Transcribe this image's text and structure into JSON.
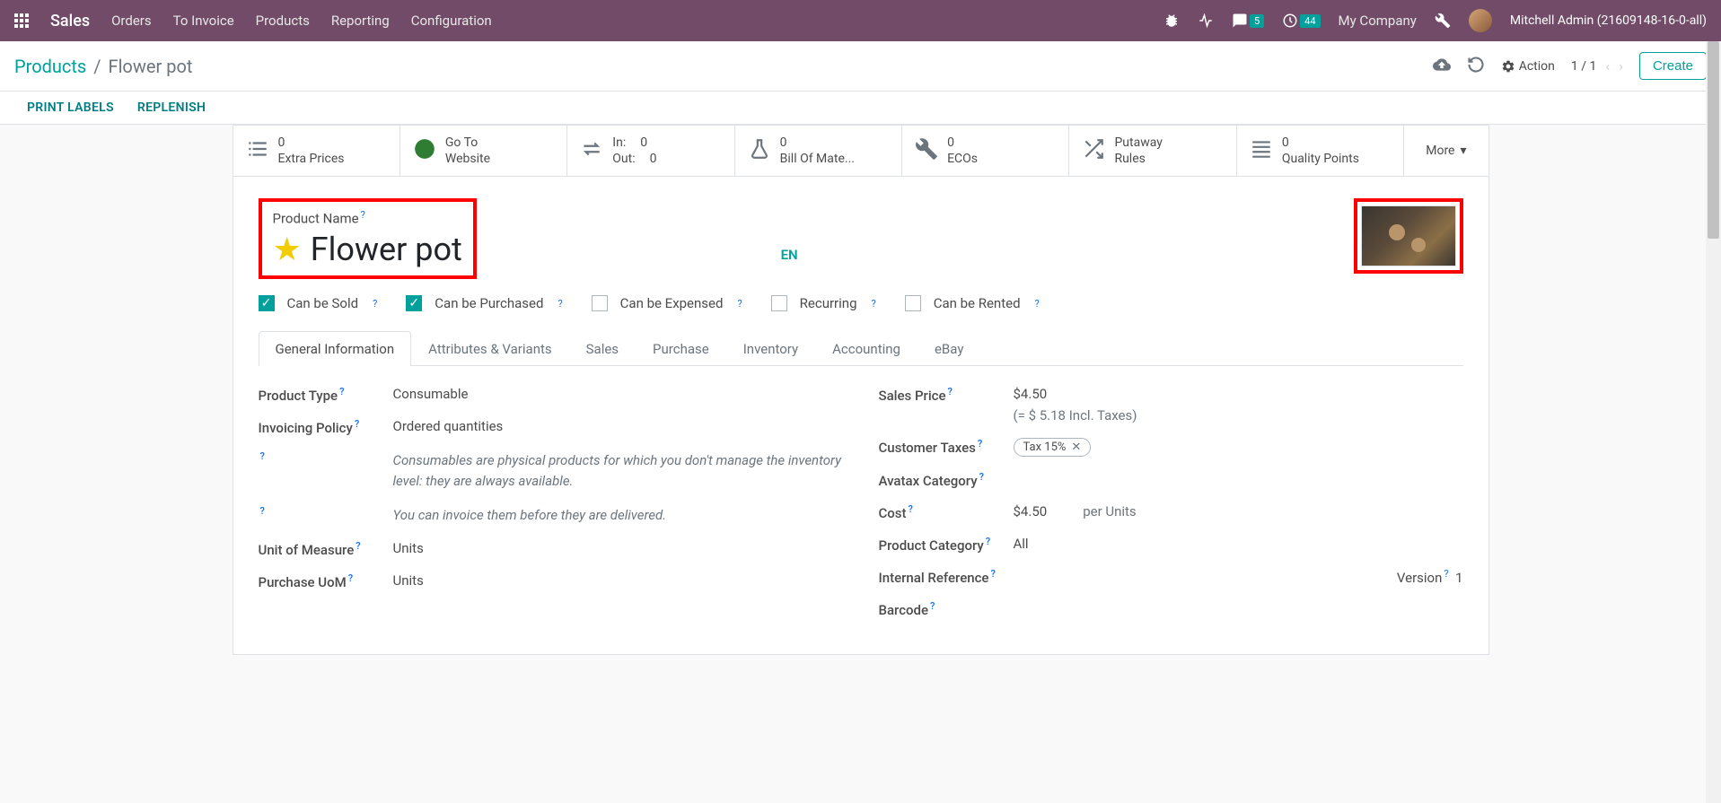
{
  "topnav": {
    "brand": "Sales",
    "menu": [
      "Orders",
      "To Invoice",
      "Products",
      "Reporting",
      "Configuration"
    ],
    "msg_badge": "5",
    "act_badge": "44",
    "company": "My Company",
    "user": "Mitchell Admin (21609148-16-0-all)"
  },
  "breadcrumb": {
    "parent": "Products",
    "current": "Flower pot"
  },
  "controls": {
    "action": "Action",
    "pager": "1 / 1",
    "create": "Create"
  },
  "subbar": {
    "print_labels": "PRINT LABELS",
    "replenish": "REPLENISH"
  },
  "stats": {
    "extra_prices": {
      "val": "0",
      "label": "Extra Prices"
    },
    "website": {
      "line1": "Go To",
      "line2": "Website"
    },
    "in": {
      "label": "In:",
      "val": "0"
    },
    "out": {
      "label": "Out:",
      "val": "0"
    },
    "bom": {
      "val": "0",
      "label": "Bill Of Mate..."
    },
    "ecos": {
      "val": "0",
      "label": "ECOs"
    },
    "putaway": {
      "line1": "Putaway",
      "line2": "Rules"
    },
    "quality": {
      "val": "0",
      "label": "Quality Points"
    },
    "more": "More"
  },
  "title": {
    "label": "Product Name",
    "name": "Flower pot",
    "lang": "EN"
  },
  "options": {
    "sold": "Can be Sold",
    "purchased": "Can be Purchased",
    "expensed": "Can be Expensed",
    "recurring": "Recurring",
    "rented": "Can be Rented"
  },
  "tabs": [
    "General Information",
    "Attributes & Variants",
    "Sales",
    "Purchase",
    "Inventory",
    "Accounting",
    "eBay"
  ],
  "general": {
    "product_type": {
      "label": "Product Type",
      "val": "Consumable"
    },
    "invoicing_policy": {
      "label": "Invoicing Policy",
      "val": "Ordered quantities"
    },
    "help1": "Consumables are physical products for which you don't manage the inventory level: they are always available.",
    "help2": "You can invoice them before they are delivered.",
    "uom": {
      "label": "Unit of Measure",
      "val": "Units"
    },
    "purchase_uom": {
      "label": "Purchase UoM",
      "val": "Units"
    },
    "sales_price": {
      "label": "Sales Price",
      "val": "$4.50",
      "incl": "(= $ 5.18 Incl. Taxes)"
    },
    "customer_taxes": {
      "label": "Customer Taxes",
      "val": "Tax 15%"
    },
    "avatax": {
      "label": "Avatax Category"
    },
    "cost": {
      "label": "Cost",
      "val": "$4.50",
      "per": "per Units"
    },
    "category": {
      "label": "Product Category",
      "val": "All"
    },
    "internal_ref": {
      "label": "Internal Reference"
    },
    "version": {
      "label": "Version",
      "val": "1"
    },
    "barcode": {
      "label": "Barcode"
    }
  }
}
